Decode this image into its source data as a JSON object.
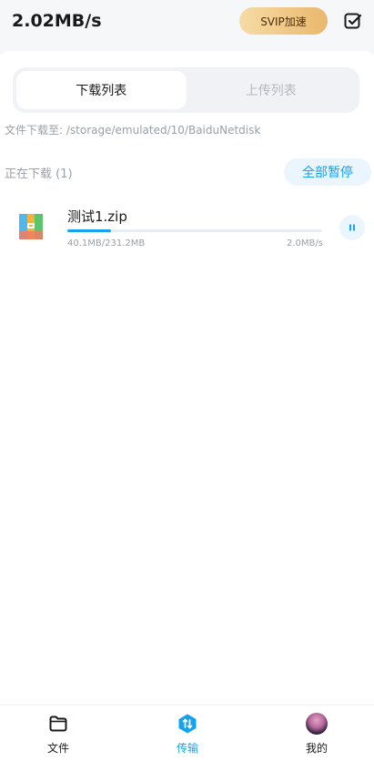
{
  "header": {
    "speed": "2.02MB/s",
    "svip_label": "SVIP加速"
  },
  "tabs": [
    {
      "label": "下载列表",
      "active": true
    },
    {
      "label": "上传列表",
      "active": false
    }
  ],
  "path": "文件下载至: /storage/emulated/10/BaiduNetdisk",
  "section": {
    "title": "正在下载 (1)",
    "pause_all_label": "全部暂停"
  },
  "download_item": {
    "file_name": "测试1.zip",
    "size": "40.1MB/231.2MB",
    "rate": "2.0MB/s",
    "progress_fraction": 0.17,
    "icon": "zip-file-icon"
  },
  "bottom_nav": [
    {
      "label": "文件",
      "icon": "folder-icon",
      "active": false
    },
    {
      "label": "传输",
      "icon": "transfer-icon",
      "active": true
    },
    {
      "label": "我的",
      "icon": "avatar",
      "active": false
    }
  ],
  "colors": {
    "accent": "#13a3ef",
    "svip_gradient_start": "#f7dba6",
    "svip_gradient_end": "#e9b86c"
  }
}
